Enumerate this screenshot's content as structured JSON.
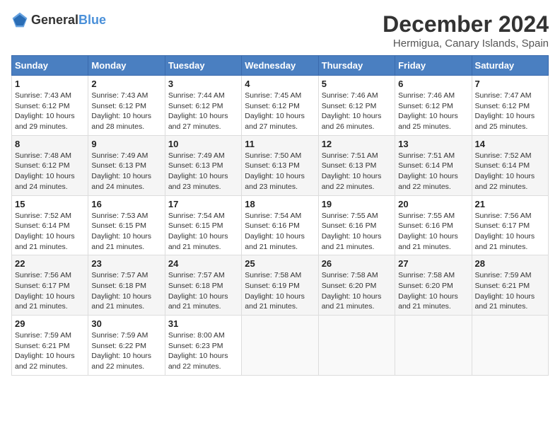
{
  "header": {
    "logo_general": "General",
    "logo_blue": "Blue",
    "month_title": "December 2024",
    "subtitle": "Hermigua, Canary Islands, Spain"
  },
  "weekdays": [
    "Sunday",
    "Monday",
    "Tuesday",
    "Wednesday",
    "Thursday",
    "Friday",
    "Saturday"
  ],
  "weeks": [
    [
      {
        "day": "1",
        "sunrise": "7:43 AM",
        "sunset": "6:12 PM",
        "daylight": "10 hours and 29 minutes."
      },
      {
        "day": "2",
        "sunrise": "7:43 AM",
        "sunset": "6:12 PM",
        "daylight": "10 hours and 28 minutes."
      },
      {
        "day": "3",
        "sunrise": "7:44 AM",
        "sunset": "6:12 PM",
        "daylight": "10 hours and 27 minutes."
      },
      {
        "day": "4",
        "sunrise": "7:45 AM",
        "sunset": "6:12 PM",
        "daylight": "10 hours and 27 minutes."
      },
      {
        "day": "5",
        "sunrise": "7:46 AM",
        "sunset": "6:12 PM",
        "daylight": "10 hours and 26 minutes."
      },
      {
        "day": "6",
        "sunrise": "7:46 AM",
        "sunset": "6:12 PM",
        "daylight": "10 hours and 25 minutes."
      },
      {
        "day": "7",
        "sunrise": "7:47 AM",
        "sunset": "6:12 PM",
        "daylight": "10 hours and 25 minutes."
      }
    ],
    [
      {
        "day": "8",
        "sunrise": "7:48 AM",
        "sunset": "6:12 PM",
        "daylight": "10 hours and 24 minutes."
      },
      {
        "day": "9",
        "sunrise": "7:49 AM",
        "sunset": "6:13 PM",
        "daylight": "10 hours and 24 minutes."
      },
      {
        "day": "10",
        "sunrise": "7:49 AM",
        "sunset": "6:13 PM",
        "daylight": "10 hours and 23 minutes."
      },
      {
        "day": "11",
        "sunrise": "7:50 AM",
        "sunset": "6:13 PM",
        "daylight": "10 hours and 23 minutes."
      },
      {
        "day": "12",
        "sunrise": "7:51 AM",
        "sunset": "6:13 PM",
        "daylight": "10 hours and 22 minutes."
      },
      {
        "day": "13",
        "sunrise": "7:51 AM",
        "sunset": "6:14 PM",
        "daylight": "10 hours and 22 minutes."
      },
      {
        "day": "14",
        "sunrise": "7:52 AM",
        "sunset": "6:14 PM",
        "daylight": "10 hours and 22 minutes."
      }
    ],
    [
      {
        "day": "15",
        "sunrise": "7:52 AM",
        "sunset": "6:14 PM",
        "daylight": "10 hours and 21 minutes."
      },
      {
        "day": "16",
        "sunrise": "7:53 AM",
        "sunset": "6:15 PM",
        "daylight": "10 hours and 21 minutes."
      },
      {
        "day": "17",
        "sunrise": "7:54 AM",
        "sunset": "6:15 PM",
        "daylight": "10 hours and 21 minutes."
      },
      {
        "day": "18",
        "sunrise": "7:54 AM",
        "sunset": "6:16 PM",
        "daylight": "10 hours and 21 minutes."
      },
      {
        "day": "19",
        "sunrise": "7:55 AM",
        "sunset": "6:16 PM",
        "daylight": "10 hours and 21 minutes."
      },
      {
        "day": "20",
        "sunrise": "7:55 AM",
        "sunset": "6:16 PM",
        "daylight": "10 hours and 21 minutes."
      },
      {
        "day": "21",
        "sunrise": "7:56 AM",
        "sunset": "6:17 PM",
        "daylight": "10 hours and 21 minutes."
      }
    ],
    [
      {
        "day": "22",
        "sunrise": "7:56 AM",
        "sunset": "6:17 PM",
        "daylight": "10 hours and 21 minutes."
      },
      {
        "day": "23",
        "sunrise": "7:57 AM",
        "sunset": "6:18 PM",
        "daylight": "10 hours and 21 minutes."
      },
      {
        "day": "24",
        "sunrise": "7:57 AM",
        "sunset": "6:18 PM",
        "daylight": "10 hours and 21 minutes."
      },
      {
        "day": "25",
        "sunrise": "7:58 AM",
        "sunset": "6:19 PM",
        "daylight": "10 hours and 21 minutes."
      },
      {
        "day": "26",
        "sunrise": "7:58 AM",
        "sunset": "6:20 PM",
        "daylight": "10 hours and 21 minutes."
      },
      {
        "day": "27",
        "sunrise": "7:58 AM",
        "sunset": "6:20 PM",
        "daylight": "10 hours and 21 minutes."
      },
      {
        "day": "28",
        "sunrise": "7:59 AM",
        "sunset": "6:21 PM",
        "daylight": "10 hours and 21 minutes."
      }
    ],
    [
      {
        "day": "29",
        "sunrise": "7:59 AM",
        "sunset": "6:21 PM",
        "daylight": "10 hours and 22 minutes."
      },
      {
        "day": "30",
        "sunrise": "7:59 AM",
        "sunset": "6:22 PM",
        "daylight": "10 hours and 22 minutes."
      },
      {
        "day": "31",
        "sunrise": "8:00 AM",
        "sunset": "6:23 PM",
        "daylight": "10 hours and 22 minutes."
      },
      null,
      null,
      null,
      null
    ]
  ],
  "labels": {
    "sunrise": "Sunrise:",
    "sunset": "Sunset:",
    "daylight": "Daylight:"
  }
}
